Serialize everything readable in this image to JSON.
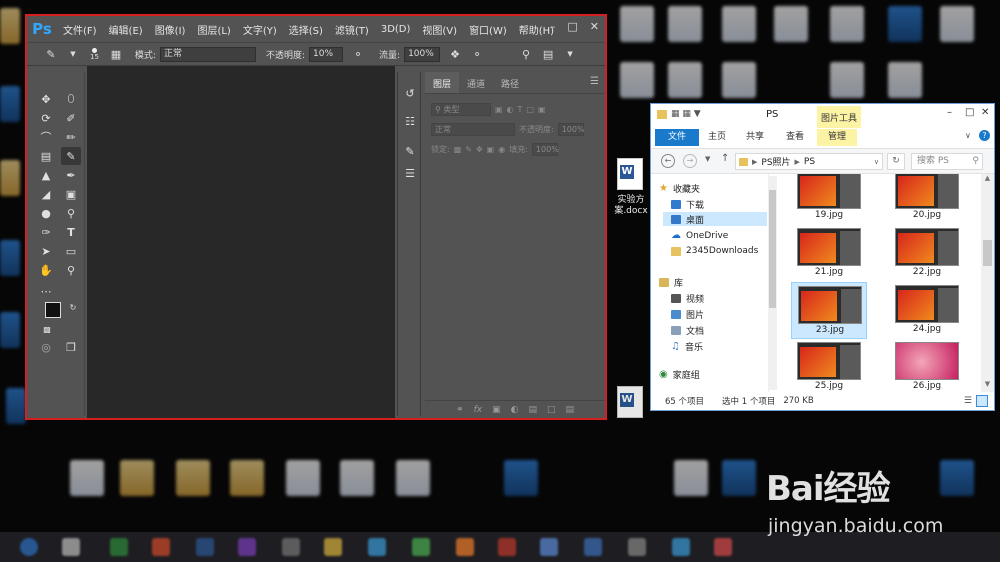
{
  "photoshop": {
    "logo": "Ps",
    "menu": [
      "文件(F)",
      "编辑(E)",
      "图像(I)",
      "图层(L)",
      "文字(Y)",
      "选择(S)",
      "滤镜(T)",
      "3D(D)",
      "视图(V)",
      "窗口(W)",
      "帮助(H)"
    ],
    "options": {
      "brush_size": "15",
      "mode_label": "模式:",
      "mode_value": "正常",
      "opacity_label": "不透明度:",
      "opacity_value": "10%",
      "flow_label": "流量:",
      "flow_value": "100%"
    },
    "panel_tabs": [
      "图层",
      "通道",
      "路径"
    ],
    "layers": {
      "filter_label": "类型",
      "blend_value": "正常",
      "opacity_label": "不透明度:",
      "opacity_value": "100%",
      "lock_label": "锁定:",
      "fill_label": "填充:",
      "fill_value": "100%"
    },
    "layer_footer_fx": "fx"
  },
  "explorer": {
    "title": "PS",
    "picture_tools": "图片工具",
    "ribbon_tabs": [
      "文件",
      "主页",
      "共享",
      "查看",
      "管理"
    ],
    "breadcrumb": [
      "PS照片",
      "PS"
    ],
    "search_placeholder": "搜索 PS",
    "nav": {
      "favorites": "收藏夹",
      "downloads": "下载",
      "desktop": "桌面",
      "onedrive": "OneDrive",
      "downloads2345": "2345Downloads",
      "library": "库",
      "videos": "视频",
      "pictures": "图片",
      "documents": "文档",
      "music": "音乐",
      "homegroup": "家庭组"
    },
    "files": [
      "19.jpg",
      "20.jpg",
      "21.jpg",
      "22.jpg",
      "23.jpg",
      "24.jpg",
      "25.jpg",
      "26.jpg"
    ],
    "selected_file": "23.jpg",
    "status": {
      "count": "65 个项目",
      "selected": "选中 1 个项目",
      "size": "270 KB"
    }
  },
  "desktop": {
    "docx_label": "实验方案.docx"
  },
  "watermark": {
    "logo": "Bai经验",
    "url": "jingyan.baidu.com"
  },
  "colors": {
    "ps_frame_highlight": "#d62020",
    "ps_blue": "#31a8ff",
    "explorer_accent": "#1979ca",
    "background_swatch": "#7aa25a",
    "foreground_swatch": "#111111"
  }
}
